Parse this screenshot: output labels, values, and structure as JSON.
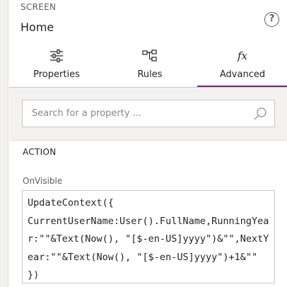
{
  "header": {
    "kind": "SCREEN",
    "title": "Home",
    "help_glyph": "?"
  },
  "tabs": [
    {
      "label": "Properties",
      "icon": "sliders-icon"
    },
    {
      "label": "Rules",
      "icon": "flowchart-icon"
    },
    {
      "label": "Advanced",
      "icon": "fx-icon",
      "glyph": "fx",
      "selected": true
    }
  ],
  "search": {
    "placeholder": "Search for a property ...",
    "value": ""
  },
  "section": {
    "title": "ACTION"
  },
  "property": {
    "name": "OnVisible",
    "formula": "UpdateContext({\nCurrentUserName:User().FullName,RunningYear:\"\"&Text(Now(), \"[$-en-US]yyyy\")&\"\",NextYear:\"\"&Text(Now(), \"[$-en-US]yyyy\")+1&\"\" })"
  },
  "colors": {
    "accent": "#742774",
    "panel_bg": "#f3f2f1",
    "border": "#c8c6c4"
  }
}
